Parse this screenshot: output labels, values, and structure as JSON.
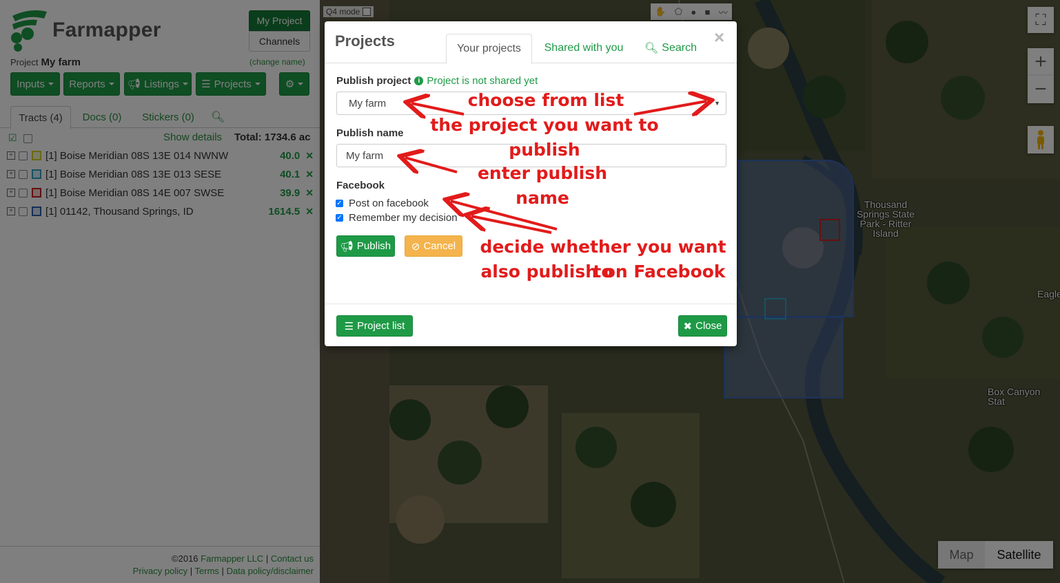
{
  "app": {
    "brand": "Farmapper",
    "project_label": "Project",
    "project_name": "My farm",
    "change_name": "(change name)",
    "my_project_btn": "My Project",
    "channels_btn": "Channels"
  },
  "toolbar": {
    "inputs": "Inputs",
    "reports": "Reports",
    "listings": "Listings",
    "projects": "Projects",
    "settings_icon": "gears-icon"
  },
  "tabs": {
    "tracts": "Tracts (4)",
    "docs": "Docs (0)",
    "stickers": "Stickers (0)"
  },
  "tract_list": {
    "show_details": "Show details",
    "total": "Total: 1734.6 ac",
    "rows": [
      {
        "name": "[1] Boise Meridian 08S 13E 014 NWNW",
        "area": "40.0",
        "color": "#d6d21f"
      },
      {
        "name": "[1] Boise Meridian 08S 13E 013 SESE",
        "area": "40.1",
        "color": "#2fa3c7"
      },
      {
        "name": "[1] Boise Meridian 08S 14E 007 SWSE",
        "area": "39.9",
        "color": "#c9201f"
      },
      {
        "name": "[1] 01142, Thousand Springs, ID",
        "area": "1614.5",
        "color": "#2c5fb0"
      }
    ]
  },
  "footer": {
    "copyright": "©2016",
    "company": "Farmapper LLC",
    "sep1": "|",
    "contact": "Contact us",
    "privacy": "Privacy policy",
    "terms": "Terms",
    "data_policy": "Data policy/disclaimer"
  },
  "map": {
    "q4_mode": "Q4 mode",
    "map_btn": "Map",
    "satellite_btn": "Satellite",
    "places": {
      "thousand_springs": "Thousand Springs State Park - Ritter Island",
      "box_canyon": "Box Canyon Stat",
      "eagle": "Eagle"
    }
  },
  "modal": {
    "title": "Projects",
    "tabs": [
      "Your projects",
      "Shared with you",
      "Search"
    ],
    "publish_project_label": "Publish project",
    "not_shared": "Project is not shared yet",
    "selected_project": "My farm",
    "publish_name_label": "Publish name",
    "publish_name_value": "My farm",
    "facebook_label": "Facebook",
    "post_on_facebook": "Post on facebook",
    "remember_decision": "Remember my decision",
    "publish_btn": "Publish",
    "cancel_btn": "Cancel",
    "project_list_btn": "Project list",
    "close_btn": "Close"
  },
  "annotations": {
    "choose_line1": "choose from list",
    "choose_line2": "the project you want to publish",
    "enter_name": "enter publish name",
    "facebook_line1": "decide whether you want to",
    "facebook_line2": "also publish on Facebook"
  },
  "colors": {
    "brand_green": "#1e9a46",
    "cancel_orange": "#f4b34c",
    "annotation_red": "#e21b1b",
    "link_green": "#2b8f3e"
  }
}
